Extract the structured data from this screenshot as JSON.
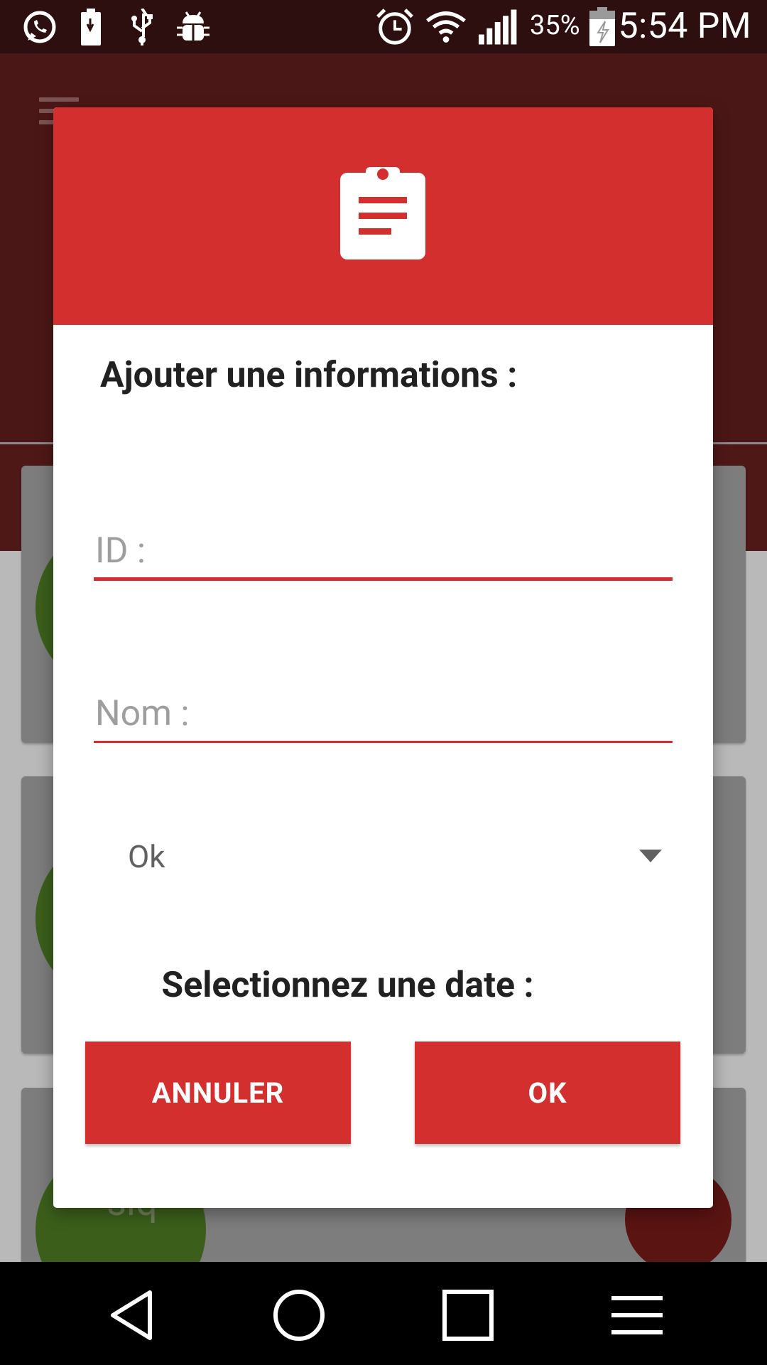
{
  "status_bar": {
    "time": "5:54 PM",
    "battery_percent": "35%",
    "icons": [
      "whatsapp-icon",
      "battery-charging-icon",
      "usb-icon",
      "android-debug-icon",
      "alarm-icon",
      "wifi-icon",
      "signal-icon",
      "battery-icon"
    ]
  },
  "background": {
    "card_avatar_text": "siq"
  },
  "dialog": {
    "header_icon": "clipboard-icon",
    "title": "Ajouter une informations :",
    "id_placeholder": "ID :",
    "nom_placeholder": "Nom :",
    "select_value": "Ok",
    "date_label": "Selectionnez une date :",
    "cancel_label": "ANNULER",
    "ok_label": "OK"
  },
  "nav_bar": {
    "icons": [
      "back-icon",
      "home-icon",
      "recents-icon",
      "menu-icon"
    ]
  },
  "colors": {
    "accent": "#d32f2f",
    "status_bar": "#2e0f0f",
    "nav_bar": "#000000"
  }
}
